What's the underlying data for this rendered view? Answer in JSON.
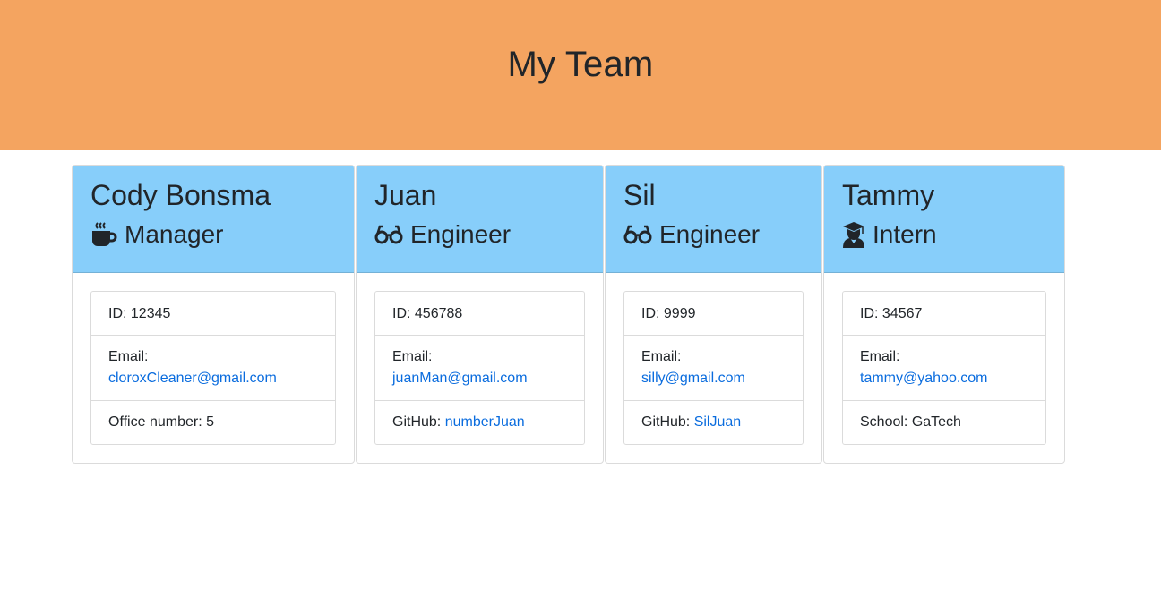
{
  "header": {
    "title": "My Team"
  },
  "team": [
    {
      "name": "Cody Bonsma",
      "role": "Manager",
      "role_icon": "mug-icon",
      "id_label": "ID: 12345",
      "email_label": "Email:",
      "email": "cloroxCleaner@gmail.com",
      "extra_label": "Office number: 5",
      "extra_link": ""
    },
    {
      "name": "Juan",
      "role": "Engineer",
      "role_icon": "glasses-icon",
      "id_label": "ID: 456788",
      "email_label": "Email:",
      "email": "juanMan@gmail.com",
      "extra_label": "GitHub: ",
      "extra_link": "numberJuan"
    },
    {
      "name": "Sil",
      "role": "Engineer",
      "role_icon": "glasses-icon",
      "id_label": "ID: 9999",
      "email_label": "Email:",
      "email": "silly@gmail.com",
      "extra_label": "GitHub: ",
      "extra_link": "SilJuan"
    },
    {
      "name": "Tammy",
      "role": "Intern",
      "role_icon": "graduate-icon",
      "id_label": "ID: 34567",
      "email_label": "Email:",
      "email": "tammy@yahoo.com",
      "extra_label": "School: GaTech",
      "extra_link": ""
    }
  ],
  "colors": {
    "header_bg": "#f4a460",
    "card_header_bg": "#87cefa",
    "link": "#0a6cde"
  }
}
